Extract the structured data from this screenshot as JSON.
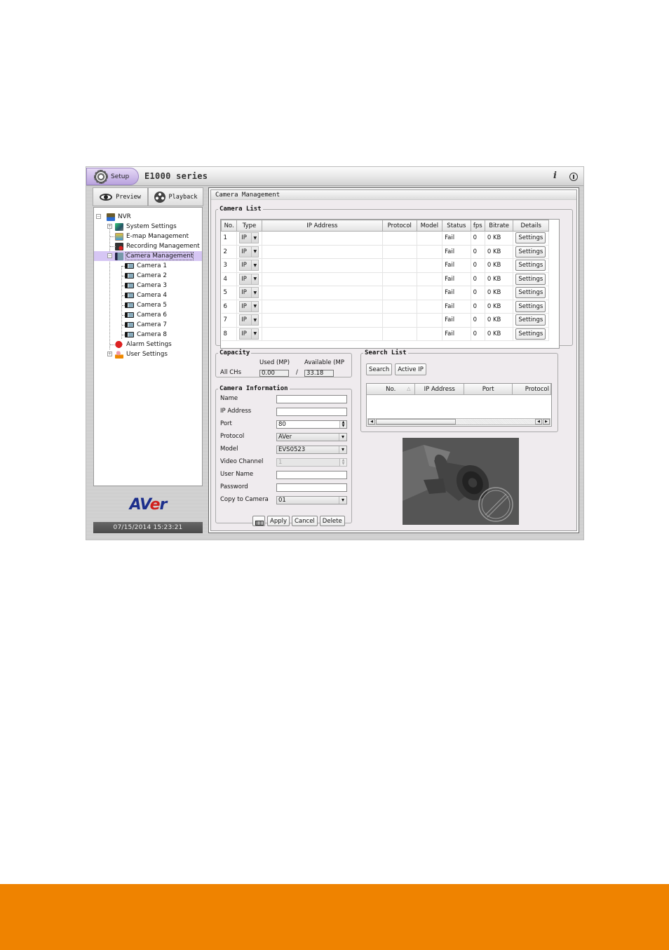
{
  "app": {
    "setup_label": "Setup",
    "product": "E1000 series",
    "info_icon": "i",
    "brand_color": "#1c2f8c",
    "accent_color": "#ef8300"
  },
  "left": {
    "tabs": [
      {
        "label": "Preview",
        "icon": "eye-icon"
      },
      {
        "label": "Playback",
        "icon": "film-reel-icon"
      }
    ],
    "tree": {
      "root": "NVR",
      "items": [
        {
          "label": "System Settings"
        },
        {
          "label": "E-map Management"
        },
        {
          "label": "Recording Management"
        },
        {
          "label": "Camera Management",
          "selected": true
        },
        {
          "label": "Camera 1"
        },
        {
          "label": "Camera 2"
        },
        {
          "label": "Camera 3"
        },
        {
          "label": "Camera 4"
        },
        {
          "label": "Camera 5"
        },
        {
          "label": "Camera 6"
        },
        {
          "label": "Camera 7"
        },
        {
          "label": "Camera 8"
        },
        {
          "label": "Alarm Settings"
        },
        {
          "label": "User Settings"
        }
      ]
    },
    "logo_a": "AV",
    "logo_e": "e",
    "logo_r": "r",
    "datetime": "07/15/2014 15:23:21"
  },
  "main": {
    "title": "Camera Management",
    "camera_list": {
      "legend": "Camera List",
      "columns": [
        "No.",
        "Type",
        "IP Address",
        "Protocol",
        "Model",
        "Status",
        "fps",
        "Bitrate",
        "Details"
      ],
      "rows": [
        {
          "no": "1",
          "type": "IP",
          "ip": "",
          "protocol": "",
          "model": "",
          "status": "Fail",
          "fps": "0",
          "bitrate": "0 KB",
          "details": "Settings"
        },
        {
          "no": "2",
          "type": "IP",
          "ip": "",
          "protocol": "",
          "model": "",
          "status": "Fail",
          "fps": "0",
          "bitrate": "0 KB",
          "details": "Settings"
        },
        {
          "no": "3",
          "type": "IP",
          "ip": "",
          "protocol": "",
          "model": "",
          "status": "Fail",
          "fps": "0",
          "bitrate": "0 KB",
          "details": "Settings"
        },
        {
          "no": "4",
          "type": "IP",
          "ip": "",
          "protocol": "",
          "model": "",
          "status": "Fail",
          "fps": "0",
          "bitrate": "0 KB",
          "details": "Settings"
        },
        {
          "no": "5",
          "type": "IP",
          "ip": "",
          "protocol": "",
          "model": "",
          "status": "Fail",
          "fps": "0",
          "bitrate": "0 KB",
          "details": "Settings"
        },
        {
          "no": "6",
          "type": "IP",
          "ip": "",
          "protocol": "",
          "model": "",
          "status": "Fail",
          "fps": "0",
          "bitrate": "0 KB",
          "details": "Settings"
        },
        {
          "no": "7",
          "type": "IP",
          "ip": "",
          "protocol": "",
          "model": "",
          "status": "Fail",
          "fps": "0",
          "bitrate": "0 KB",
          "details": "Settings"
        },
        {
          "no": "8",
          "type": "IP",
          "ip": "",
          "protocol": "",
          "model": "",
          "status": "Fail",
          "fps": "0",
          "bitrate": "0 KB",
          "details": "Settings"
        }
      ]
    },
    "capacity": {
      "legend": "Capacity",
      "used_label": "Used (MP)",
      "available_label": "Available (MP",
      "row_label": "All CHs",
      "used": "0.00",
      "separator": "/",
      "available": "33.18"
    },
    "camera_info": {
      "legend": "Camera Information",
      "name_label": "Name",
      "name": "",
      "ip_label": "IP Address",
      "ip": "",
      "port_label": "Port",
      "port": "80",
      "protocol_label": "Protocol",
      "protocol": "AVer",
      "model_label": "Model",
      "model": "EVS0523",
      "channel_label": "Video Channel",
      "channel": "1",
      "user_label": "User Name",
      "user": "",
      "password_label": "Password",
      "password": "",
      "copy_label": "Copy to Camera",
      "copy": "01",
      "apply": "Apply",
      "cancel": "Cancel",
      "delete": "Delete"
    },
    "search_list": {
      "legend": "Search List",
      "search_btn": "Search",
      "active_ip_btn": "Active IP",
      "columns": [
        "No.",
        "IP Address",
        "Port",
        "Protocol"
      ],
      "sort_indicator": "△"
    }
  }
}
